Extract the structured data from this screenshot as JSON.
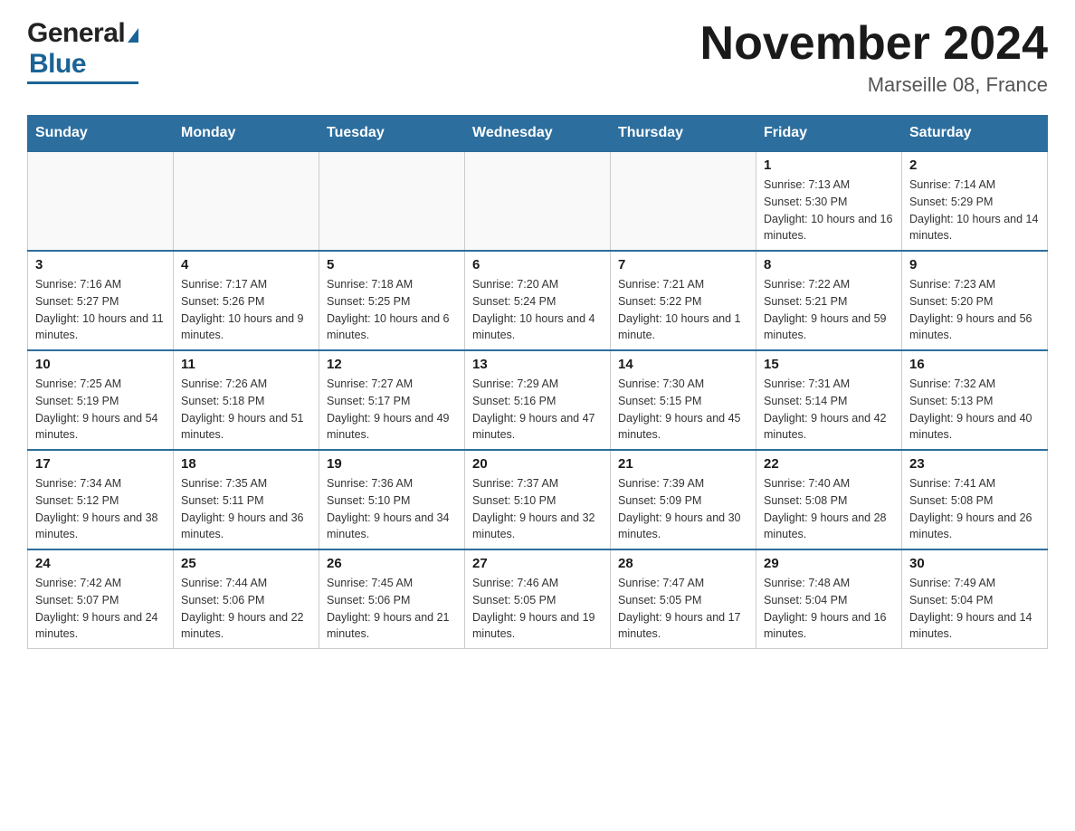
{
  "header": {
    "logo_general": "General",
    "logo_blue": "Blue",
    "month_title": "November 2024",
    "location": "Marseille 08, France"
  },
  "days_of_week": [
    "Sunday",
    "Monday",
    "Tuesday",
    "Wednesday",
    "Thursday",
    "Friday",
    "Saturday"
  ],
  "weeks": [
    {
      "cells": [
        {
          "day": "",
          "info": ""
        },
        {
          "day": "",
          "info": ""
        },
        {
          "day": "",
          "info": ""
        },
        {
          "day": "",
          "info": ""
        },
        {
          "day": "",
          "info": ""
        },
        {
          "day": "1",
          "info": "Sunrise: 7:13 AM\nSunset: 5:30 PM\nDaylight: 10 hours and 16 minutes."
        },
        {
          "day": "2",
          "info": "Sunrise: 7:14 AM\nSunset: 5:29 PM\nDaylight: 10 hours and 14 minutes."
        }
      ]
    },
    {
      "cells": [
        {
          "day": "3",
          "info": "Sunrise: 7:16 AM\nSunset: 5:27 PM\nDaylight: 10 hours and 11 minutes."
        },
        {
          "day": "4",
          "info": "Sunrise: 7:17 AM\nSunset: 5:26 PM\nDaylight: 10 hours and 9 minutes."
        },
        {
          "day": "5",
          "info": "Sunrise: 7:18 AM\nSunset: 5:25 PM\nDaylight: 10 hours and 6 minutes."
        },
        {
          "day": "6",
          "info": "Sunrise: 7:20 AM\nSunset: 5:24 PM\nDaylight: 10 hours and 4 minutes."
        },
        {
          "day": "7",
          "info": "Sunrise: 7:21 AM\nSunset: 5:22 PM\nDaylight: 10 hours and 1 minute."
        },
        {
          "day": "8",
          "info": "Sunrise: 7:22 AM\nSunset: 5:21 PM\nDaylight: 9 hours and 59 minutes."
        },
        {
          "day": "9",
          "info": "Sunrise: 7:23 AM\nSunset: 5:20 PM\nDaylight: 9 hours and 56 minutes."
        }
      ]
    },
    {
      "cells": [
        {
          "day": "10",
          "info": "Sunrise: 7:25 AM\nSunset: 5:19 PM\nDaylight: 9 hours and 54 minutes."
        },
        {
          "day": "11",
          "info": "Sunrise: 7:26 AM\nSunset: 5:18 PM\nDaylight: 9 hours and 51 minutes."
        },
        {
          "day": "12",
          "info": "Sunrise: 7:27 AM\nSunset: 5:17 PM\nDaylight: 9 hours and 49 minutes."
        },
        {
          "day": "13",
          "info": "Sunrise: 7:29 AM\nSunset: 5:16 PM\nDaylight: 9 hours and 47 minutes."
        },
        {
          "day": "14",
          "info": "Sunrise: 7:30 AM\nSunset: 5:15 PM\nDaylight: 9 hours and 45 minutes."
        },
        {
          "day": "15",
          "info": "Sunrise: 7:31 AM\nSunset: 5:14 PM\nDaylight: 9 hours and 42 minutes."
        },
        {
          "day": "16",
          "info": "Sunrise: 7:32 AM\nSunset: 5:13 PM\nDaylight: 9 hours and 40 minutes."
        }
      ]
    },
    {
      "cells": [
        {
          "day": "17",
          "info": "Sunrise: 7:34 AM\nSunset: 5:12 PM\nDaylight: 9 hours and 38 minutes."
        },
        {
          "day": "18",
          "info": "Sunrise: 7:35 AM\nSunset: 5:11 PM\nDaylight: 9 hours and 36 minutes."
        },
        {
          "day": "19",
          "info": "Sunrise: 7:36 AM\nSunset: 5:10 PM\nDaylight: 9 hours and 34 minutes."
        },
        {
          "day": "20",
          "info": "Sunrise: 7:37 AM\nSunset: 5:10 PM\nDaylight: 9 hours and 32 minutes."
        },
        {
          "day": "21",
          "info": "Sunrise: 7:39 AM\nSunset: 5:09 PM\nDaylight: 9 hours and 30 minutes."
        },
        {
          "day": "22",
          "info": "Sunrise: 7:40 AM\nSunset: 5:08 PM\nDaylight: 9 hours and 28 minutes."
        },
        {
          "day": "23",
          "info": "Sunrise: 7:41 AM\nSunset: 5:08 PM\nDaylight: 9 hours and 26 minutes."
        }
      ]
    },
    {
      "cells": [
        {
          "day": "24",
          "info": "Sunrise: 7:42 AM\nSunset: 5:07 PM\nDaylight: 9 hours and 24 minutes."
        },
        {
          "day": "25",
          "info": "Sunrise: 7:44 AM\nSunset: 5:06 PM\nDaylight: 9 hours and 22 minutes."
        },
        {
          "day": "26",
          "info": "Sunrise: 7:45 AM\nSunset: 5:06 PM\nDaylight: 9 hours and 21 minutes."
        },
        {
          "day": "27",
          "info": "Sunrise: 7:46 AM\nSunset: 5:05 PM\nDaylight: 9 hours and 19 minutes."
        },
        {
          "day": "28",
          "info": "Sunrise: 7:47 AM\nSunset: 5:05 PM\nDaylight: 9 hours and 17 minutes."
        },
        {
          "day": "29",
          "info": "Sunrise: 7:48 AM\nSunset: 5:04 PM\nDaylight: 9 hours and 16 minutes."
        },
        {
          "day": "30",
          "info": "Sunrise: 7:49 AM\nSunset: 5:04 PM\nDaylight: 9 hours and 14 minutes."
        }
      ]
    }
  ]
}
